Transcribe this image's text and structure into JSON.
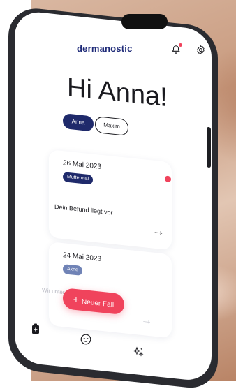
{
  "app": {
    "logo": "dermanostic",
    "greeting": "Hi Anna!"
  },
  "header": {
    "icons": [
      "bell-icon",
      "gear-icon"
    ]
  },
  "profiles": [
    {
      "label": "Anna",
      "active": true
    },
    {
      "label": "Maxim",
      "active": false
    }
  ],
  "cases": [
    {
      "date": "26 Mai 2023",
      "tag": "Muttermal",
      "message": "Dein Befund liegt vor",
      "arrow": "→",
      "unread": true
    },
    {
      "date": "24 Mai 2023",
      "tag": "Akne",
      "message": "Wir unter",
      "arrow": "→",
      "unread": false
    }
  ],
  "fab": {
    "label": "Neuer Fall",
    "plus": "+"
  },
  "tabbar": {
    "icons": [
      "case-icon",
      "face-icon",
      "sparkle-icon"
    ]
  },
  "colors": {
    "brand": "#1e2a78",
    "accent": "#f0435c",
    "tag_dark": "#1f2a6b",
    "tag_light": "#7083b6"
  }
}
